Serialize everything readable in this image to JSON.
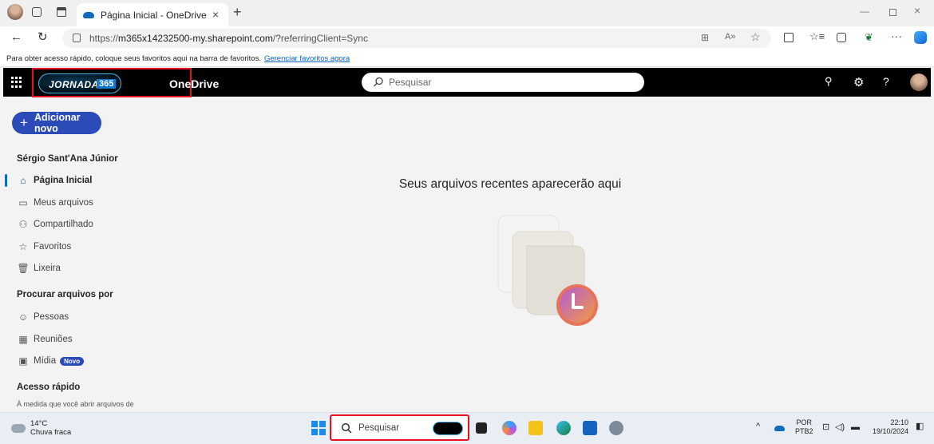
{
  "browser": {
    "tab_title": "Página Inicial - OneDrive",
    "url_prefix": "https://",
    "url_host": "m365x14232500-my.sharepoint.com",
    "url_path": "/?referringClient=Sync",
    "favorites_msg": "Para obter acesso rápido, coloque seus favoritos aqui na barra de favoritos.",
    "favorites_link": "Gerenciar favoritos agora"
  },
  "header": {
    "logo_text": "JORNADA",
    "logo_num": "365",
    "app_name": "OneDrive",
    "search_placeholder": "Pesquisar"
  },
  "nav": {
    "new_button": "Adicionar novo",
    "user_name": "Sérgio Sant'Ana Júnior",
    "items": [
      {
        "label": "Página Inicial",
        "icon": "home-icon"
      },
      {
        "label": "Meus arquivos",
        "icon": "folder-icon"
      },
      {
        "label": "Compartilhado",
        "icon": "people-icon"
      },
      {
        "label": "Favoritos",
        "icon": "star-icon"
      },
      {
        "label": "Lixeira",
        "icon": "trash-icon"
      }
    ],
    "browse_heading": "Procurar arquivos por",
    "browse_items": [
      {
        "label": "Pessoas",
        "icon": "person-icon"
      },
      {
        "label": "Reuniões",
        "icon": "calendar-icon"
      },
      {
        "label": "Mídia",
        "icon": "image-icon",
        "badge": "Novo"
      }
    ],
    "quick_heading": "Acesso rápido",
    "quick_sub": "À medida que você abrir arquivos de"
  },
  "main": {
    "empty_title": "Seus arquivos recentes aparecerão aqui"
  },
  "taskbar": {
    "temp": "14°C",
    "weather": "Chuva fraca",
    "search_placeholder": "Pesquisar",
    "lang_top": "POR",
    "lang_bottom": "PTB2",
    "time": "22:10",
    "date": "19/10/2024"
  }
}
